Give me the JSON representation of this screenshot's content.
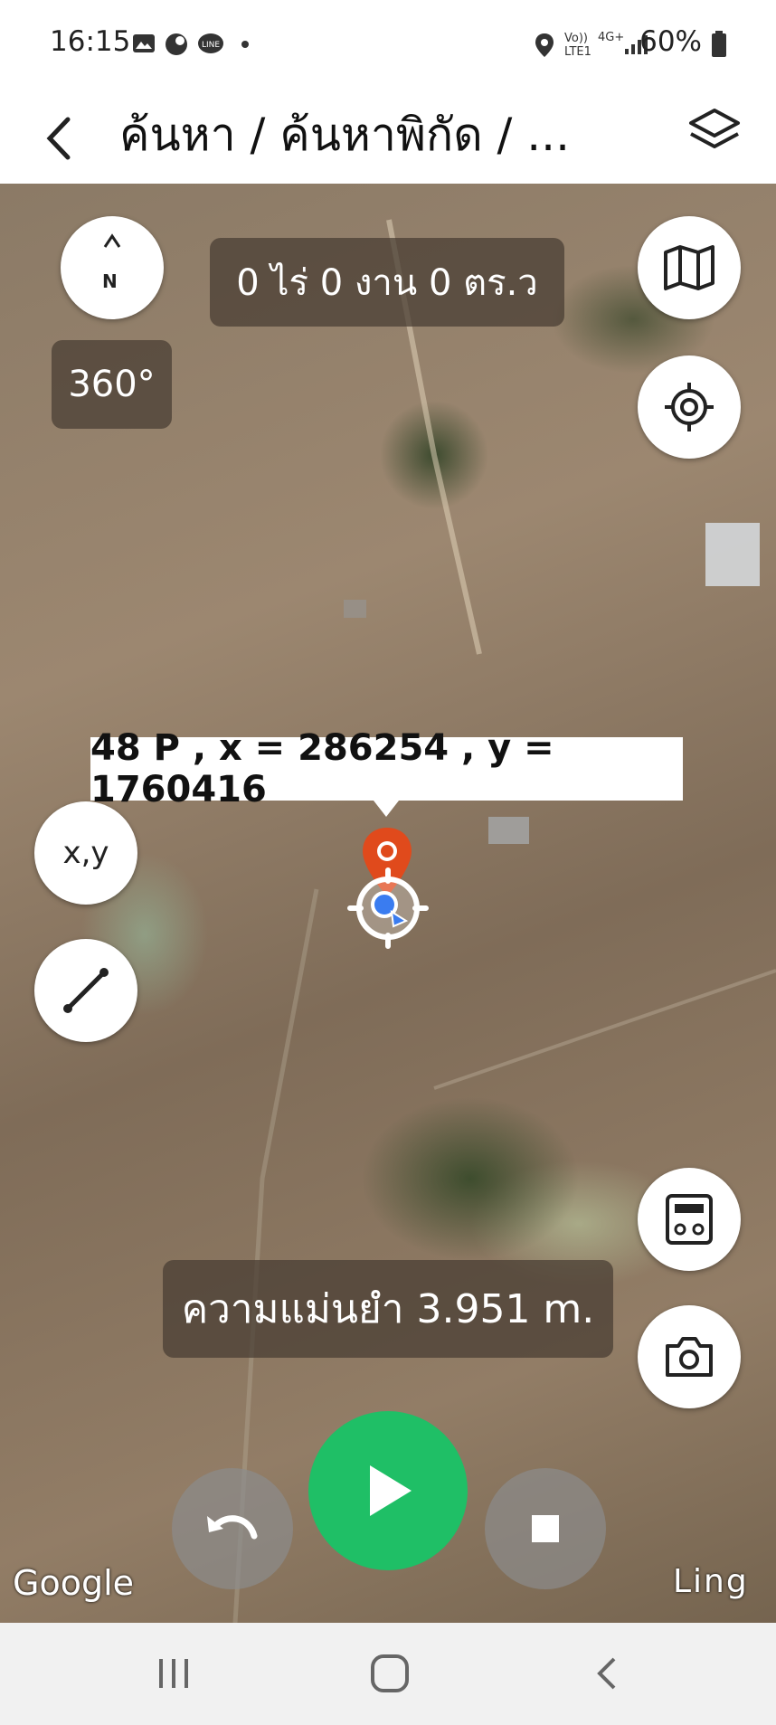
{
  "status_bar": {
    "time": "16:15",
    "network_top": "Vo))",
    "network_bottom": "LTE1",
    "signal_type": "4G+",
    "battery": "60%"
  },
  "app_bar": {
    "title": "ค้นหา / ค้นหาพิกัด / ..."
  },
  "map": {
    "compass_letter": "N",
    "area_text": "0 ไร่ 0 งาน 0 ตร.ว",
    "view_360_label": "360°",
    "coordinate_text": "48 P , x = 286254 , y = 1760416",
    "xy_button_label": "x,y",
    "accuracy_text": "ความแม่นยำ 3.951 m.",
    "google_attribution": "Google",
    "corner_label": "Ling"
  },
  "colors": {
    "play_green": "#1fbf66",
    "pin_red": "#e04a1c",
    "location_blue": "#3a7cf0"
  }
}
